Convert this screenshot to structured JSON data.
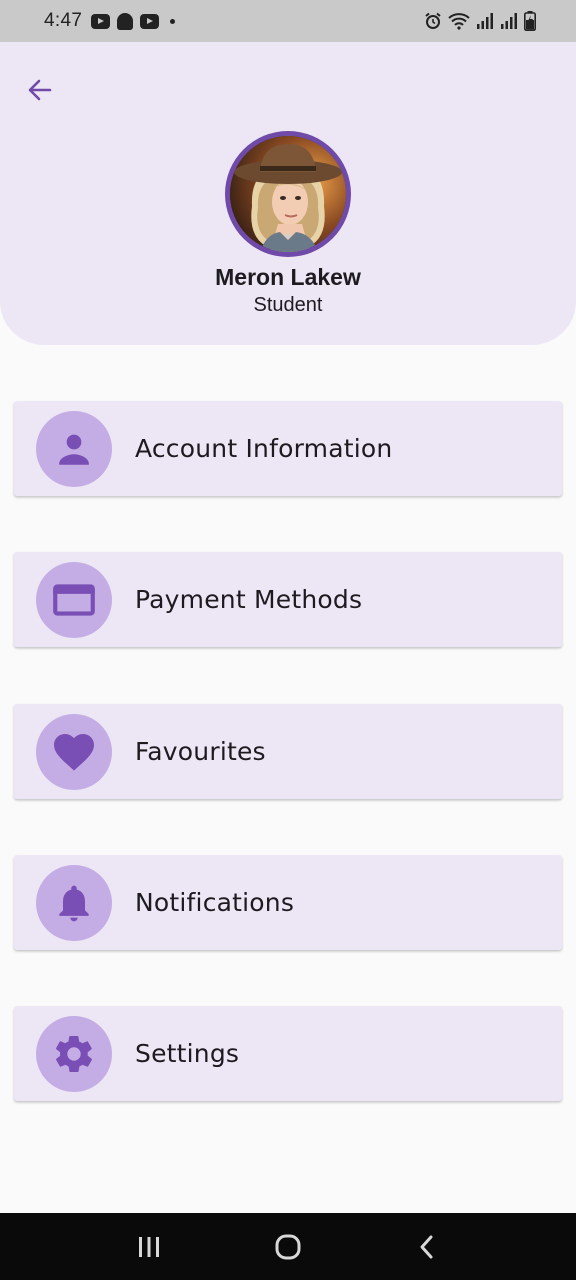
{
  "status_bar": {
    "time": "4:47",
    "notification_icons": [
      "youtube-icon",
      "snapchat-icon",
      "youtube-icon",
      "dot-icon"
    ],
    "system_icons": [
      "alarm-icon",
      "wifi-icon",
      "signal-icon",
      "signal-icon",
      "battery-charging-icon"
    ]
  },
  "header": {
    "back_icon": "arrow-left-icon",
    "profile": {
      "name": "Meron Lakew",
      "role": "Student"
    }
  },
  "menu": {
    "items": [
      {
        "label": "Account Information",
        "icon": "person-icon"
      },
      {
        "label": "Payment Methods",
        "icon": "credit-card-icon"
      },
      {
        "label": "Favourites",
        "icon": "heart-icon"
      },
      {
        "label": "Notifications",
        "icon": "bell-icon"
      },
      {
        "label": "Settings",
        "icon": "gear-icon"
      }
    ]
  },
  "nav_bar": {
    "buttons": [
      "recents-icon",
      "home-icon",
      "back-icon"
    ]
  },
  "colors": {
    "accent": "#6f4aa8",
    "header_bg": "#ede6f5",
    "card_bg": "#ede6f5",
    "icon_circle": "#c4ade4",
    "icon_fill": "#7a4fb5",
    "page_bg": "#fafafa"
  }
}
